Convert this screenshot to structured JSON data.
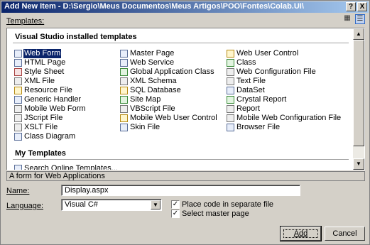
{
  "window": {
    "title": "Add New Item - D:\\Sergio\\Meus Documentos\\Meus Artigos\\POO\\Fontes\\Colab.UI\\",
    "help_glyph": "?",
    "close_glyph": "X"
  },
  "templates_label": "Templates:",
  "view_icons": {
    "large": "▦",
    "small": "☰"
  },
  "groups": {
    "installed": "Visual Studio installed templates",
    "mine": "My Templates"
  },
  "installed_items": {
    "col1": [
      "Web Form",
      "HTML Page",
      "Style Sheet",
      "XML File",
      "Resource File",
      "Generic Handler",
      "Mobile Web Form",
      "JScript File",
      "XSLT File",
      "Class Diagram"
    ],
    "col2": [
      "Master Page",
      "Web Service",
      "Global Application Class",
      "XML Schema",
      "SQL Database",
      "Site Map",
      "VBScript File",
      "Mobile Web User Control",
      "Skin File"
    ],
    "col3": [
      "Web User Control",
      "Class",
      "Web Configuration File",
      "Text File",
      "DataSet",
      "Crystal Report",
      "Report",
      "Mobile Web Configuration File",
      "Browser File"
    ]
  },
  "my_items": [
    "Search Online Templates..."
  ],
  "description": "A form for Web Applications",
  "name_label": "Name:",
  "name_value": "Display.aspx",
  "language_label": "Language:",
  "language_value": "Visual C#",
  "checks": {
    "separate_file": {
      "label": "Place code in separate file",
      "checked": true
    },
    "master_page": {
      "label": "Select master page",
      "checked": true
    }
  },
  "check_glyph": "✓",
  "buttons": {
    "add": "Add",
    "cancel": "Cancel"
  },
  "scroll": {
    "up": "▲",
    "down": "▼"
  },
  "dropdown_glyph": "▼"
}
